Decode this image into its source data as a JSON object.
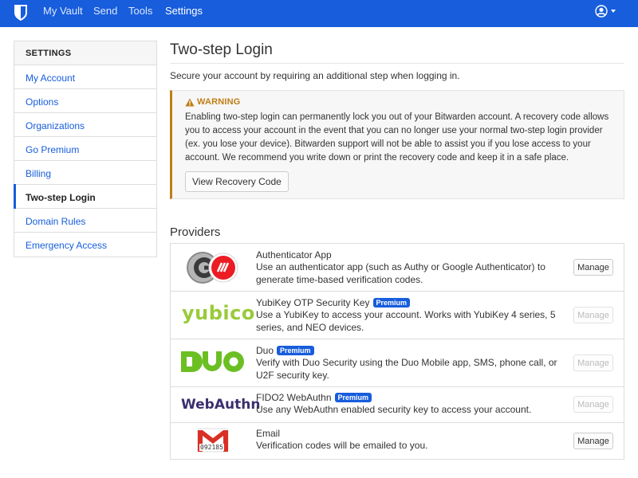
{
  "nav": {
    "items": [
      {
        "label": "My Vault"
      },
      {
        "label": "Send"
      },
      {
        "label": "Tools"
      },
      {
        "label": "Settings"
      }
    ]
  },
  "sidebar": {
    "header": "SETTINGS",
    "items": [
      {
        "label": "My Account"
      },
      {
        "label": "Options"
      },
      {
        "label": "Organizations"
      },
      {
        "label": "Go Premium"
      },
      {
        "label": "Billing"
      },
      {
        "label": "Two-step Login"
      },
      {
        "label": "Domain Rules"
      },
      {
        "label": "Emergency Access"
      }
    ]
  },
  "main": {
    "title": "Two-step Login",
    "subtitle": "Secure your account by requiring an additional step when logging in.",
    "warning": {
      "title": "WARNING",
      "text": "Enabling two-step login can permanently lock you out of your Bitwarden account. A recovery code allows you to access your account in the event that you can no longer use your normal two-step login provider (ex. you lose your device). Bitwarden support will not be able to assist you if you lose access to your account. We recommend you write down or print the recovery code and keep it in a safe place.",
      "button_label": "View Recovery Code"
    },
    "providers_title": "Providers",
    "providers": [
      {
        "name": "Authenticator App",
        "description": "Use an authenticator app (such as Authy or Google Authenticator) to generate time-based verification codes.",
        "button_label": "Manage"
      },
      {
        "name": "YubiKey OTP Security Key",
        "badge": "Premium",
        "logo_text": "yubico",
        "description": "Use a YubiKey to access your account. Works with YubiKey 4 series, 5 series, and NEO devices.",
        "button_label": "Manage"
      },
      {
        "name": "Duo",
        "badge": "Premium",
        "logo_text": "DUO",
        "description": "Verify with Duo Security using the Duo Mobile app, SMS, phone call, or U2F security key.",
        "button_label": "Manage"
      },
      {
        "name": "FIDO2 WebAuthn",
        "badge": "Premium",
        "logo_text": "WebAuthn",
        "description": "Use any WebAuthn enabled security key to access your account.",
        "button_label": "Manage"
      },
      {
        "name": "Email",
        "logo_text": "092185",
        "description": "Verification codes will be emailed to you.",
        "button_label": "Manage"
      }
    ]
  },
  "colors": {
    "brand": "#175ddc",
    "warning": "#bf7e16"
  }
}
